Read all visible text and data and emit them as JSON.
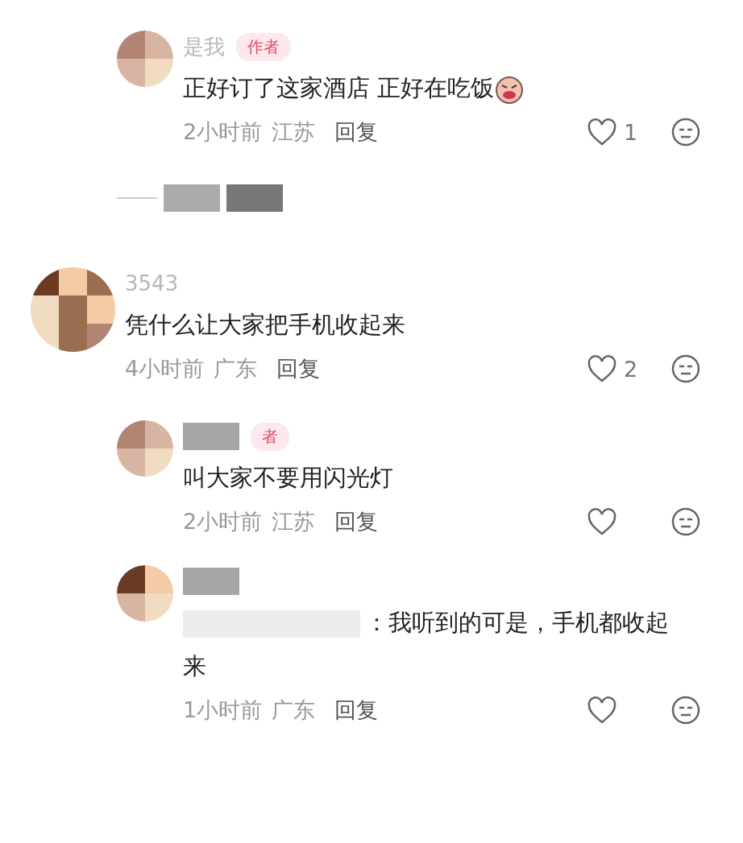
{
  "comments": [
    {
      "kind": "reply",
      "author": "是我",
      "badge": "作者",
      "text": "正好订了这家酒店 正好在吃饭",
      "emoji": true,
      "time": "2小时前",
      "location": "江苏",
      "reply_label": "回复",
      "likes": "1"
    },
    {
      "kind": "expand"
    },
    {
      "kind": "top",
      "author": "3543",
      "text": "凭什么让大家把手机收起来",
      "time": "4小时前",
      "location": "广东",
      "reply_label": "回复",
      "likes": "2"
    },
    {
      "kind": "reply",
      "badge": "者",
      "text": "叫大家不要用闪光灯",
      "time": "2小时前",
      "location": "江苏",
      "reply_label": "回复"
    },
    {
      "kind": "reply",
      "text": "：我听到的可是，手机都收起来",
      "quoted": true,
      "time": "1小时前",
      "location": "广东",
      "reply_label": "回复"
    }
  ]
}
